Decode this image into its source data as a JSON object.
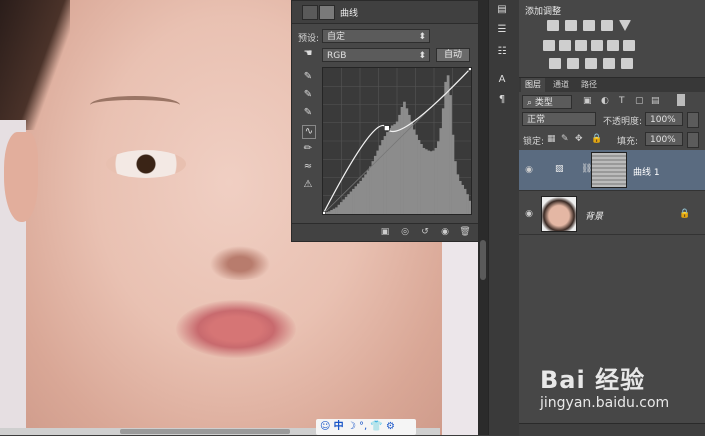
{
  "curves_panel": {
    "title": "曲线",
    "preset_label": "预设:",
    "preset_value": "自定",
    "channel_value": "RGB",
    "auto_button": "自动"
  },
  "adjustments_panel": {
    "title": "添加调整"
  },
  "layers_panel": {
    "tabs": [
      "图层",
      "通道",
      "路径"
    ],
    "filter_kind": "类型",
    "blend_mode": "正常",
    "opacity_label": "不透明度:",
    "opacity_value": "100%",
    "lock_label": "锁定:",
    "fill_label": "填充:",
    "fill_value": "100%",
    "layers": [
      {
        "name": "曲线 1",
        "type": "adjustment",
        "selected": true
      },
      {
        "name": "背景",
        "type": "image",
        "selected": false
      }
    ]
  },
  "ime_bar": {
    "lang": "中"
  },
  "watermark": {
    "brand": "Bai  经验",
    "url": "jingyan.baidu.com"
  },
  "chart_data": {
    "type": "line",
    "title": "",
    "xlabel": "",
    "ylabel": "",
    "xlim": [
      0,
      255
    ],
    "ylim": [
      0,
      255
    ],
    "curve_points": [
      [
        0,
        0
      ],
      [
        110,
        150
      ],
      [
        255,
        255
      ]
    ],
    "histogram": [
      2,
      3,
      4,
      6,
      8,
      10,
      14,
      18,
      22,
      26,
      30,
      34,
      38,
      42,
      46,
      50,
      55,
      60,
      66,
      72,
      80,
      88,
      96,
      104,
      112,
      118,
      124,
      130,
      134,
      136,
      140,
      150,
      162,
      170,
      160,
      150,
      140,
      128,
      120,
      112,
      106,
      100,
      98,
      96,
      95,
      96,
      100,
      110,
      130,
      160,
      200,
      210,
      180,
      120,
      80,
      60,
      50,
      44,
      38,
      30,
      20
    ]
  }
}
